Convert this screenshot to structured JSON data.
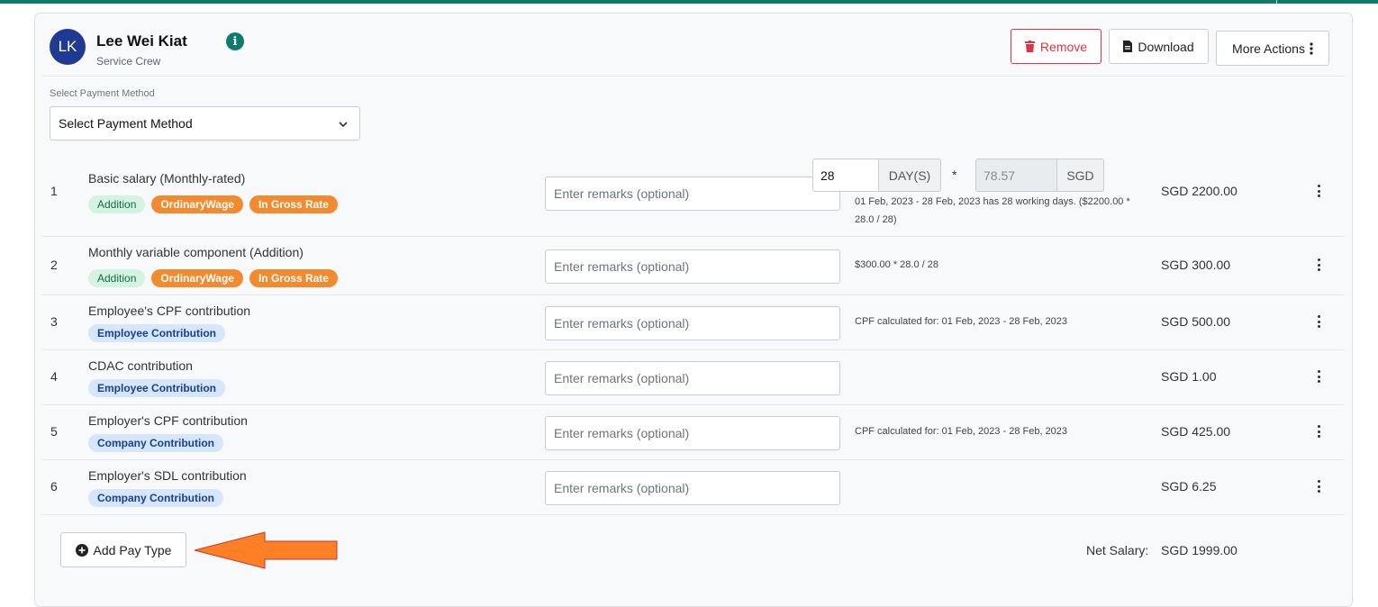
{
  "employee": {
    "initials": "LK",
    "name": "Lee Wei Kiat",
    "role": "Service Crew"
  },
  "header_actions": {
    "remove_label": "Remove",
    "download_label": "Download",
    "more_label": "More Actions"
  },
  "payment_method": {
    "label": "Select Payment Method",
    "selected": "Select Payment Method"
  },
  "remarks_placeholder": "Enter remarks (optional)",
  "rows": [
    {
      "num": "1",
      "title": "Basic salary (Monthly-rated)",
      "badges": [
        "Addition",
        "OrdinaryWage",
        "In Gross Rate"
      ],
      "days_value": "28",
      "days_unit": "DAY(S)",
      "multiply": "*",
      "rate_value": "78.57",
      "rate_unit": "SGD",
      "note_line1": "01 Feb, 2023 - 28 Feb, 2023 has 28 working days. ($2200.00 *",
      "note_line2": "28.0 / 28)",
      "amount": "SGD 2200.00"
    },
    {
      "num": "2",
      "title": "Monthly variable component (Addition)",
      "badges": [
        "Addition",
        "OrdinaryWage",
        "In Gross Rate"
      ],
      "note": "$300.00 * 28.0 / 28",
      "amount": "SGD 300.00"
    },
    {
      "num": "3",
      "title": "Employee's CPF contribution",
      "badges": [
        "Employee Contribution"
      ],
      "note": "CPF calculated for: 01 Feb, 2023 - 28 Feb, 2023",
      "amount": "SGD 500.00"
    },
    {
      "num": "4",
      "title": "CDAC contribution",
      "badges": [
        "Employee Contribution"
      ],
      "note": "",
      "amount": "SGD 1.00"
    },
    {
      "num": "5",
      "title": "Employer's CPF contribution",
      "badges": [
        "Company Contribution"
      ],
      "note": "CPF calculated for: 01 Feb, 2023 - 28 Feb, 2023",
      "amount": "SGD 425.00"
    },
    {
      "num": "6",
      "title": "Employer's SDL contribution",
      "badges": [
        "Company Contribution"
      ],
      "note": "",
      "amount": "SGD 6.25"
    }
  ],
  "footer": {
    "add_pay_type_label": "Add Pay Type",
    "net_salary_label": "Net Salary:",
    "net_salary_value": "SGD 1999.00"
  },
  "colors": {
    "brand_teal": "#0f7b6c",
    "avatar_navy": "#1f3a93",
    "danger": "#dc3545",
    "badge_orange": "#f28a2f",
    "arrow_orange": "#ff7f27"
  },
  "icons": {
    "info": "info-icon",
    "remove": "trash-icon",
    "download": "pdf-file-icon",
    "more": "vertical-dots-icon",
    "select": "chevron-down-icon",
    "row_menu": "kebab-menu-icon",
    "add": "plus-circle-icon",
    "pointer": "left-arrow-annotation"
  }
}
